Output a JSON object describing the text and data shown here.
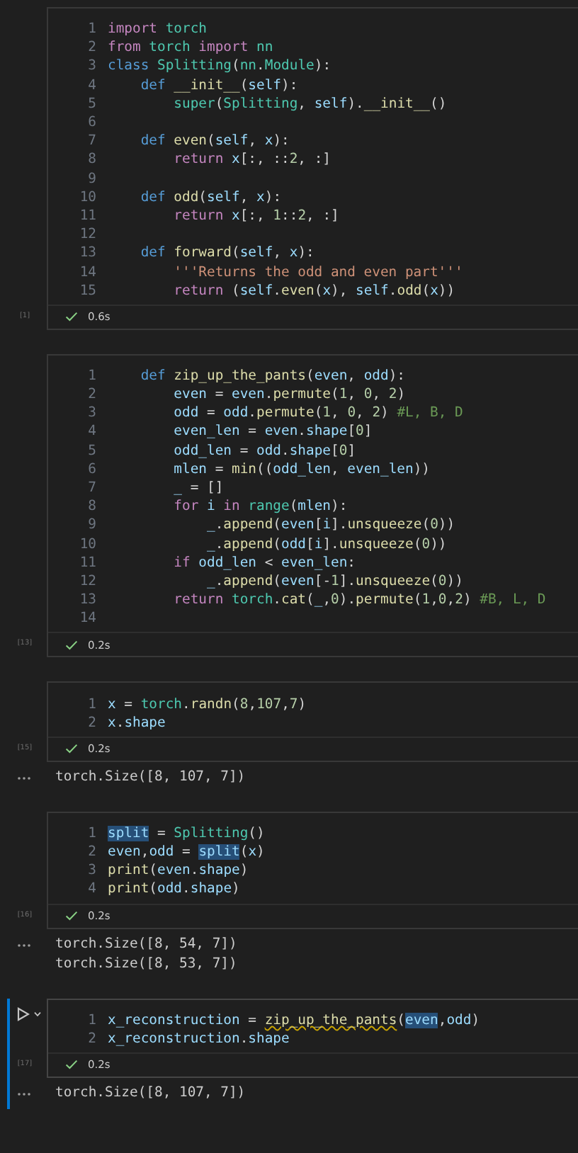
{
  "cells": [
    {
      "selected": false,
      "count": "[1]",
      "time": "0.6s",
      "lines": [
        {
          "n": "1",
          "tokens": [
            {
              "text": "import",
              "kind": "kw"
            },
            {
              "text": " torch",
              "kind": "mod"
            }
          ]
        },
        {
          "n": "2",
          "tokens": [
            {
              "text": "from",
              "kind": "kw"
            },
            {
              "text": " torch ",
              "kind": "mod"
            },
            {
              "text": "import",
              "kind": "kw"
            },
            {
              "text": " nn",
              "kind": "mod"
            }
          ]
        },
        {
          "n": "3",
          "tokens": [
            {
              "text": "class",
              "kind": "def"
            },
            {
              "text": " Splitting",
              "kind": "mod"
            },
            {
              "text": "(",
              "kind": "p"
            },
            {
              "text": "nn",
              "kind": "mod"
            },
            {
              "text": ".",
              "kind": "p"
            },
            {
              "text": "Module",
              "kind": "mod"
            },
            {
              "text": "):",
              "kind": "p"
            }
          ]
        },
        {
          "n": "4",
          "tokens": [
            {
              "text": "    def",
              "kind": "def"
            },
            {
              "text": " __init__",
              "kind": "fn"
            },
            {
              "text": "(",
              "kind": "p"
            },
            {
              "text": "self",
              "kind": "var"
            },
            {
              "text": "):",
              "kind": "p"
            }
          ]
        },
        {
          "n": "5",
          "tokens": [
            {
              "text": "        super",
              "kind": "mod"
            },
            {
              "text": "(",
              "kind": "p"
            },
            {
              "text": "Splitting",
              "kind": "mod"
            },
            {
              "text": ", ",
              "kind": "p"
            },
            {
              "text": "self",
              "kind": "var"
            },
            {
              "text": ").",
              "kind": "p"
            },
            {
              "text": "__init__",
              "kind": "fn"
            },
            {
              "text": "()",
              "kind": "p"
            }
          ]
        },
        {
          "n": "6"
        },
        {
          "n": "7",
          "tokens": [
            {
              "text": "    def",
              "kind": "def"
            },
            {
              "text": " even",
              "kind": "fn"
            },
            {
              "text": "(",
              "kind": "p"
            },
            {
              "text": "self",
              "kind": "var"
            },
            {
              "text": ", ",
              "kind": "p"
            },
            {
              "text": "x",
              "kind": "var"
            },
            {
              "text": "):",
              "kind": "p"
            }
          ]
        },
        {
          "n": "8",
          "tokens": [
            {
              "text": "        return",
              "kind": "kw"
            },
            {
              "text": " x",
              "kind": "var"
            },
            {
              "text": "[:, ::",
              "kind": "p"
            },
            {
              "text": "2",
              "kind": "num"
            },
            {
              "text": ", :]",
              "kind": "p"
            }
          ]
        },
        {
          "n": "9"
        },
        {
          "n": "10",
          "tokens": [
            {
              "text": "    def",
              "kind": "def"
            },
            {
              "text": " odd",
              "kind": "fn"
            },
            {
              "text": "(",
              "kind": "p"
            },
            {
              "text": "self",
              "kind": "var"
            },
            {
              "text": ", ",
              "kind": "p"
            },
            {
              "text": "x",
              "kind": "var"
            },
            {
              "text": "):",
              "kind": "p"
            }
          ]
        },
        {
          "n": "11",
          "tokens": [
            {
              "text": "        return",
              "kind": "kw"
            },
            {
              "text": " x",
              "kind": "var"
            },
            {
              "text": "[:, ",
              "kind": "p"
            },
            {
              "text": "1",
              "kind": "num"
            },
            {
              "text": "::",
              "kind": "p"
            },
            {
              "text": "2",
              "kind": "num"
            },
            {
              "text": ", :]",
              "kind": "p"
            }
          ]
        },
        {
          "n": "12"
        },
        {
          "n": "13",
          "tokens": [
            {
              "text": "    def",
              "kind": "def"
            },
            {
              "text": " forward",
              "kind": "fn"
            },
            {
              "text": "(",
              "kind": "p"
            },
            {
              "text": "self",
              "kind": "var"
            },
            {
              "text": ", ",
              "kind": "p"
            },
            {
              "text": "x",
              "kind": "var"
            },
            {
              "text": "):",
              "kind": "p"
            }
          ]
        },
        {
          "n": "14",
          "tokens": [
            {
              "text": "        '''Returns the odd and even part'''",
              "kind": "str"
            }
          ]
        },
        {
          "n": "15",
          "tokens": [
            {
              "text": "        return",
              "kind": "kw"
            },
            {
              "text": " (",
              "kind": "p"
            },
            {
              "text": "self",
              "kind": "var"
            },
            {
              "text": ".",
              "kind": "p"
            },
            {
              "text": "even",
              "kind": "fn"
            },
            {
              "text": "(",
              "kind": "p"
            },
            {
              "text": "x",
              "kind": "var"
            },
            {
              "text": "), ",
              "kind": "p"
            },
            {
              "text": "self",
              "kind": "var"
            },
            {
              "text": ".",
              "kind": "p"
            },
            {
              "text": "odd",
              "kind": "fn"
            },
            {
              "text": "(",
              "kind": "p"
            },
            {
              "text": "x",
              "kind": "var"
            },
            {
              "text": "))",
              "kind": "p"
            }
          ]
        }
      ]
    },
    {
      "selected": false,
      "count": "[13]",
      "time": "0.2s",
      "lines": [
        {
          "n": "1",
          "tokens": [
            {
              "text": "    def",
              "kind": "def"
            },
            {
              "text": " zip_up_the_pants",
              "kind": "fn"
            },
            {
              "text": "(",
              "kind": "p"
            },
            {
              "text": "even",
              "kind": "var"
            },
            {
              "text": ", ",
              "kind": "p"
            },
            {
              "text": "odd",
              "kind": "var"
            },
            {
              "text": "):",
              "kind": "p"
            }
          ]
        },
        {
          "n": "2",
          "tokens": [
            {
              "text": "        even",
              "kind": "var"
            },
            {
              "text": " = ",
              "kind": "p"
            },
            {
              "text": "even",
              "kind": "var"
            },
            {
              "text": ".",
              "kind": "p"
            },
            {
              "text": "permute",
              "kind": "fn"
            },
            {
              "text": "(",
              "kind": "p"
            },
            {
              "text": "1",
              "kind": "num"
            },
            {
              "text": ", ",
              "kind": "p"
            },
            {
              "text": "0",
              "kind": "num"
            },
            {
              "text": ", ",
              "kind": "p"
            },
            {
              "text": "2",
              "kind": "num"
            },
            {
              "text": ")",
              "kind": "p"
            }
          ]
        },
        {
          "n": "3",
          "tokens": [
            {
              "text": "        odd",
              "kind": "var"
            },
            {
              "text": " = ",
              "kind": "p"
            },
            {
              "text": "odd",
              "kind": "var"
            },
            {
              "text": ".",
              "kind": "p"
            },
            {
              "text": "permute",
              "kind": "fn"
            },
            {
              "text": "(",
              "kind": "p"
            },
            {
              "text": "1",
              "kind": "num"
            },
            {
              "text": ", ",
              "kind": "p"
            },
            {
              "text": "0",
              "kind": "num"
            },
            {
              "text": ", ",
              "kind": "p"
            },
            {
              "text": "2",
              "kind": "num"
            },
            {
              "text": ") ",
              "kind": "p"
            },
            {
              "text": "#L, B, D",
              "kind": "cm"
            }
          ]
        },
        {
          "n": "4",
          "tokens": [
            {
              "text": "        even_len",
              "kind": "var"
            },
            {
              "text": " = ",
              "kind": "p"
            },
            {
              "text": "even",
              "kind": "var"
            },
            {
              "text": ".",
              "kind": "p"
            },
            {
              "text": "shape",
              "kind": "var"
            },
            {
              "text": "[",
              "kind": "p"
            },
            {
              "text": "0",
              "kind": "num"
            },
            {
              "text": "]",
              "kind": "p"
            }
          ]
        },
        {
          "n": "5",
          "tokens": [
            {
              "text": "        odd_len",
              "kind": "var"
            },
            {
              "text": " = ",
              "kind": "p"
            },
            {
              "text": "odd",
              "kind": "var"
            },
            {
              "text": ".",
              "kind": "p"
            },
            {
              "text": "shape",
              "kind": "var"
            },
            {
              "text": "[",
              "kind": "p"
            },
            {
              "text": "0",
              "kind": "num"
            },
            {
              "text": "]",
              "kind": "p"
            }
          ]
        },
        {
          "n": "6",
          "tokens": [
            {
              "text": "        mlen",
              "kind": "var"
            },
            {
              "text": " = ",
              "kind": "p"
            },
            {
              "text": "min",
              "kind": "fn"
            },
            {
              "text": "((",
              "kind": "p"
            },
            {
              "text": "odd_len",
              "kind": "var"
            },
            {
              "text": ", ",
              "kind": "p"
            },
            {
              "text": "even_len",
              "kind": "var"
            },
            {
              "text": "))",
              "kind": "p"
            }
          ]
        },
        {
          "n": "7",
          "tokens": [
            {
              "text": "        _",
              "kind": "var"
            },
            {
              "text": " = []",
              "kind": "p"
            }
          ]
        },
        {
          "n": "8",
          "tokens": [
            {
              "text": "        for",
              "kind": "kw"
            },
            {
              "text": " i ",
              "kind": "var"
            },
            {
              "text": "in",
              "kind": "kw"
            },
            {
              "text": " range",
              "kind": "mod"
            },
            {
              "text": "(",
              "kind": "p"
            },
            {
              "text": "mlen",
              "kind": "var"
            },
            {
              "text": "):",
              "kind": "p"
            }
          ]
        },
        {
          "n": "9",
          "tokens": [
            {
              "text": "            _",
              "kind": "var"
            },
            {
              "text": ".",
              "kind": "p"
            },
            {
              "text": "append",
              "kind": "fn"
            },
            {
              "text": "(",
              "kind": "p"
            },
            {
              "text": "even",
              "kind": "var"
            },
            {
              "text": "[",
              "kind": "p"
            },
            {
              "text": "i",
              "kind": "var"
            },
            {
              "text": "].",
              "kind": "p"
            },
            {
              "text": "unsqueeze",
              "kind": "fn"
            },
            {
              "text": "(",
              "kind": "p"
            },
            {
              "text": "0",
              "kind": "num"
            },
            {
              "text": "))",
              "kind": "p"
            }
          ]
        },
        {
          "n": "10",
          "tokens": [
            {
              "text": "            _",
              "kind": "var"
            },
            {
              "text": ".",
              "kind": "p"
            },
            {
              "text": "append",
              "kind": "fn"
            },
            {
              "text": "(",
              "kind": "p"
            },
            {
              "text": "odd",
              "kind": "var"
            },
            {
              "text": "[",
              "kind": "p"
            },
            {
              "text": "i",
              "kind": "var"
            },
            {
              "text": "].",
              "kind": "p"
            },
            {
              "text": "unsqueeze",
              "kind": "fn"
            },
            {
              "text": "(",
              "kind": "p"
            },
            {
              "text": "0",
              "kind": "num"
            },
            {
              "text": "))",
              "kind": "p"
            }
          ]
        },
        {
          "n": "11",
          "tokens": [
            {
              "text": "        if",
              "kind": "kw"
            },
            {
              "text": " odd_len",
              "kind": "var"
            },
            {
              "text": " < ",
              "kind": "p"
            },
            {
              "text": "even_len",
              "kind": "var"
            },
            {
              "text": ":",
              "kind": "p"
            }
          ]
        },
        {
          "n": "12",
          "tokens": [
            {
              "text": "            _",
              "kind": "var"
            },
            {
              "text": ".",
              "kind": "p"
            },
            {
              "text": "append",
              "kind": "fn"
            },
            {
              "text": "(",
              "kind": "p"
            },
            {
              "text": "even",
              "kind": "var"
            },
            {
              "text": "[-",
              "kind": "p"
            },
            {
              "text": "1",
              "kind": "num"
            },
            {
              "text": "].",
              "kind": "p"
            },
            {
              "text": "unsqueeze",
              "kind": "fn"
            },
            {
              "text": "(",
              "kind": "p"
            },
            {
              "text": "0",
              "kind": "num"
            },
            {
              "text": "))",
              "kind": "p"
            }
          ]
        },
        {
          "n": "13",
          "tokens": [
            {
              "text": "        return",
              "kind": "kw"
            },
            {
              "text": " torch",
              "kind": "mod"
            },
            {
              "text": ".",
              "kind": "p"
            },
            {
              "text": "cat",
              "kind": "fn"
            },
            {
              "text": "(",
              "kind": "p"
            },
            {
              "text": "_",
              "kind": "var"
            },
            {
              "text": ",",
              "kind": "p"
            },
            {
              "text": "0",
              "kind": "num"
            },
            {
              "text": ").",
              "kind": "p"
            },
            {
              "text": "permute",
              "kind": "fn"
            },
            {
              "text": "(",
              "kind": "p"
            },
            {
              "text": "1",
              "kind": "num"
            },
            {
              "text": ",",
              "kind": "p"
            },
            {
              "text": "0",
              "kind": "num"
            },
            {
              "text": ",",
              "kind": "p"
            },
            {
              "text": "2",
              "kind": "num"
            },
            {
              "text": ") ",
              "kind": "p"
            },
            {
              "text": "#B, L, D",
              "kind": "cm"
            }
          ]
        },
        {
          "n": "14"
        }
      ]
    },
    {
      "selected": false,
      "count": "[15]",
      "time": "0.2s",
      "lines": [
        {
          "n": "1",
          "tokens": [
            {
              "text": "x",
              "kind": "var"
            },
            {
              "text": " = ",
              "kind": "p"
            },
            {
              "text": "torch",
              "kind": "mod"
            },
            {
              "text": ".",
              "kind": "p"
            },
            {
              "text": "randn",
              "kind": "fn"
            },
            {
              "text": "(",
              "kind": "p"
            },
            {
              "text": "8",
              "kind": "num"
            },
            {
              "text": ",",
              "kind": "p"
            },
            {
              "text": "107",
              "kind": "num"
            },
            {
              "text": ",",
              "kind": "p"
            },
            {
              "text": "7",
              "kind": "num"
            },
            {
              "text": ")",
              "kind": "p"
            }
          ]
        },
        {
          "n": "2",
          "tokens": [
            {
              "text": "x",
              "kind": "var"
            },
            {
              "text": ".",
              "kind": "p"
            },
            {
              "text": "shape",
              "kind": "var"
            }
          ]
        }
      ],
      "outputs": [
        "torch.Size([8, 107, 7])"
      ]
    },
    {
      "selected": false,
      "count": "[16]",
      "time": "0.2s",
      "lines": [
        {
          "n": "1",
          "tokens": [
            {
              "text": "split",
              "kind": "sel"
            },
            {
              "text": " = ",
              "kind": "p"
            },
            {
              "text": "Splitting",
              "kind": "mod"
            },
            {
              "text": "()",
              "kind": "p"
            }
          ]
        },
        {
          "n": "2",
          "tokens": [
            {
              "text": "even",
              "kind": "var"
            },
            {
              "text": ",",
              "kind": "p"
            },
            {
              "text": "odd",
              "kind": "var"
            },
            {
              "text": " = ",
              "kind": "p"
            },
            {
              "text": "split",
              "kind": "sel"
            },
            {
              "text": "(",
              "kind": "p"
            },
            {
              "text": "x",
              "kind": "var"
            },
            {
              "text": ")",
              "kind": "p"
            }
          ]
        },
        {
          "n": "3",
          "tokens": [
            {
              "text": "print",
              "kind": "fn"
            },
            {
              "text": "(",
              "kind": "p"
            },
            {
              "text": "even",
              "kind": "var"
            },
            {
              "text": ".",
              "kind": "p"
            },
            {
              "text": "shape",
              "kind": "var"
            },
            {
              "text": ")",
              "kind": "p"
            }
          ]
        },
        {
          "n": "4",
          "tokens": [
            {
              "text": "print",
              "kind": "fn"
            },
            {
              "text": "(",
              "kind": "p"
            },
            {
              "text": "odd",
              "kind": "var"
            },
            {
              "text": ".",
              "kind": "p"
            },
            {
              "text": "shape",
              "kind": "var"
            },
            {
              "text": ")",
              "kind": "p"
            }
          ]
        }
      ],
      "outputs": [
        "torch.Size([8, 54, 7])",
        "torch.Size([8, 53, 7])"
      ]
    },
    {
      "selected": true,
      "count": "[17]",
      "time": "0.2s",
      "lines": [
        {
          "n": "1",
          "tokens": [
            {
              "text": "x_reconstruction",
              "kind": "var"
            },
            {
              "text": " = ",
              "kind": "p"
            },
            {
              "text": "zip_up_the_pants",
              "kind": "warn"
            },
            {
              "text": "(",
              "kind": "p"
            },
            {
              "text": "even",
              "kind": "sel"
            },
            {
              "text": ",",
              "kind": "p"
            },
            {
              "text": "odd",
              "kind": "var"
            },
            {
              "text": ")",
              "kind": "p"
            }
          ]
        },
        {
          "n": "2",
          "tokens": [
            {
              "text": "x_reconstruction",
              "kind": "var"
            },
            {
              "text": ".",
              "kind": "p"
            },
            {
              "text": "shape",
              "kind": "var"
            }
          ]
        }
      ],
      "outputs": [
        "torch.Size([8, 107, 7])"
      ]
    }
  ]
}
